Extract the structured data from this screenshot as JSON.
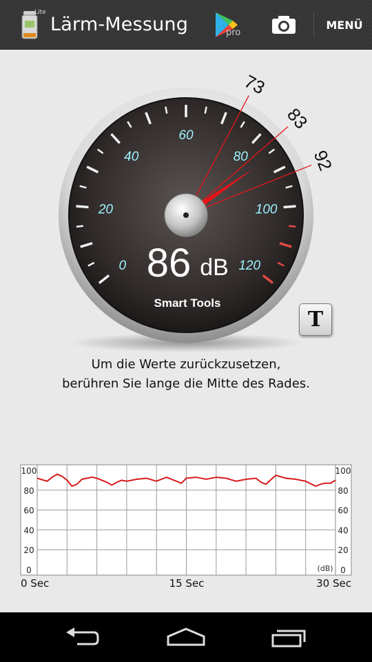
{
  "app": {
    "title": "Lärm-Messung",
    "lite_badge": "Lite",
    "menu_label": "MENÜ",
    "pro_label": "pro",
    "icons": [
      "sound-meter-app-icon",
      "google-play-icon",
      "camera-icon"
    ]
  },
  "gauge": {
    "reading": "86",
    "unit": "dB",
    "brand": "Smart Tools",
    "scale_labels": [
      "0",
      "20",
      "40",
      "60",
      "80",
      "100",
      "120"
    ],
    "markers": [
      {
        "label": "73",
        "value": 73
      },
      {
        "label": "83",
        "value": 83
      },
      {
        "label": "92",
        "value": 92
      }
    ],
    "needle_value": 86,
    "colors": {
      "scale_text": "#9ff0ff",
      "needle": "#e8141a",
      "danger_ticks": "#e04a45"
    }
  },
  "t_button": {
    "label": "T"
  },
  "hint": {
    "line1": "Um die Werte zurückzusetzen,",
    "line2": "berühren Sie lange die Mitte des Rades."
  },
  "history_chart": {
    "y_ticks": [
      "100",
      "80",
      "60",
      "40",
      "20",
      "0"
    ],
    "unit_label": "(dB)",
    "x_labels": [
      "0 Sec",
      "15 Sec",
      "30 Sec"
    ]
  },
  "chart_data": {
    "type": "line",
    "xlabel": "",
    "ylabel": "",
    "xlim": [
      0,
      30
    ],
    "ylim": [
      0,
      100
    ],
    "grid": true,
    "series": [
      {
        "color": "#d81b1b",
        "x": [
          0,
          1,
          1.5,
          2,
          2.5,
          3,
          3.5,
          4,
          4.5,
          5,
          5.5,
          6,
          7,
          7.5,
          8,
          8.5,
          9,
          10,
          11,
          12,
          13,
          14,
          14.5,
          15,
          16,
          17,
          18,
          19,
          20,
          21,
          22,
          22.5,
          23,
          24,
          25,
          26,
          27,
          28,
          28.5,
          29,
          29.5,
          30
        ],
        "y": [
          92,
          89,
          93,
          96,
          94,
          90,
          84,
          86,
          91,
          92,
          93,
          92,
          88,
          85,
          88,
          90,
          89,
          91,
          92,
          89,
          93,
          89,
          87,
          92,
          93,
          91,
          93,
          92,
          89,
          91,
          92,
          88,
          86,
          95,
          92,
          91,
          89,
          84,
          86,
          87,
          87,
          90
        ]
      }
    ]
  }
}
